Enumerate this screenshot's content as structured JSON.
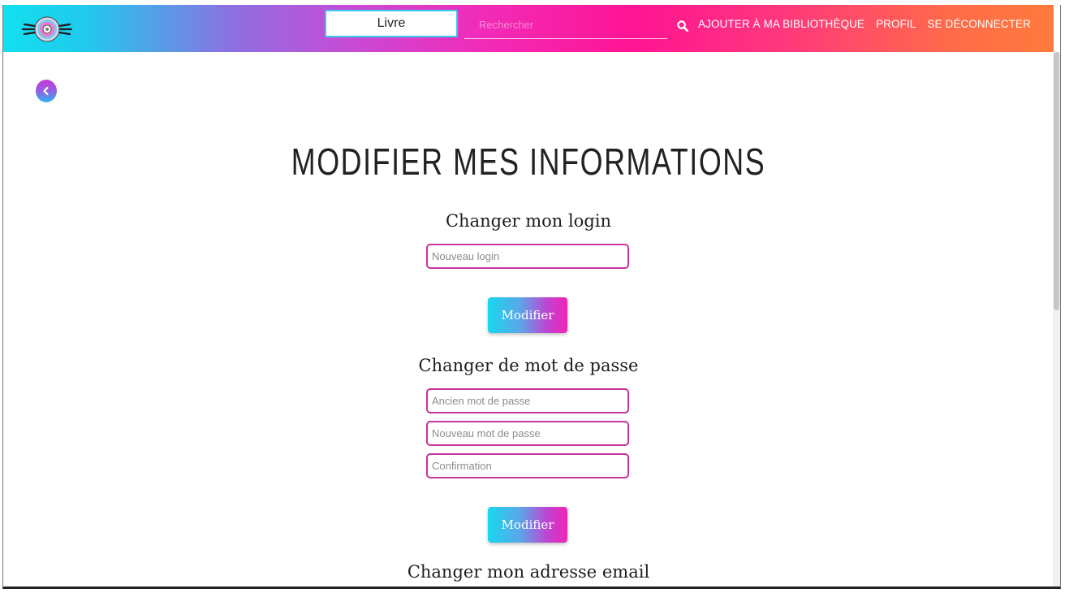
{
  "nav": {
    "category": "Livre",
    "search_placeholder": "Rechercher",
    "links": [
      "AJOUTER À MA BIBLIOTHÈQUE",
      "PROFIL",
      "SE DÉCONNECTER"
    ]
  },
  "page": {
    "title": "MODIFIER MES INFORMATIONS"
  },
  "sections": {
    "login": {
      "title": "Changer mon login",
      "new_login_placeholder": "Nouveau login",
      "button": "Modifier"
    },
    "password": {
      "title": "Changer de mot de passe",
      "old_placeholder": "Ancien mot de passe",
      "new_placeholder": "Nouveau mot de passe",
      "confirm_placeholder": "Confirmation",
      "button": "Modifier"
    },
    "email": {
      "title": "Changer mon adresse email"
    }
  },
  "colors": {
    "field_border": "#c8329b",
    "gradient_start": "#12e0ef",
    "gradient_end": "#ff7b3c"
  }
}
